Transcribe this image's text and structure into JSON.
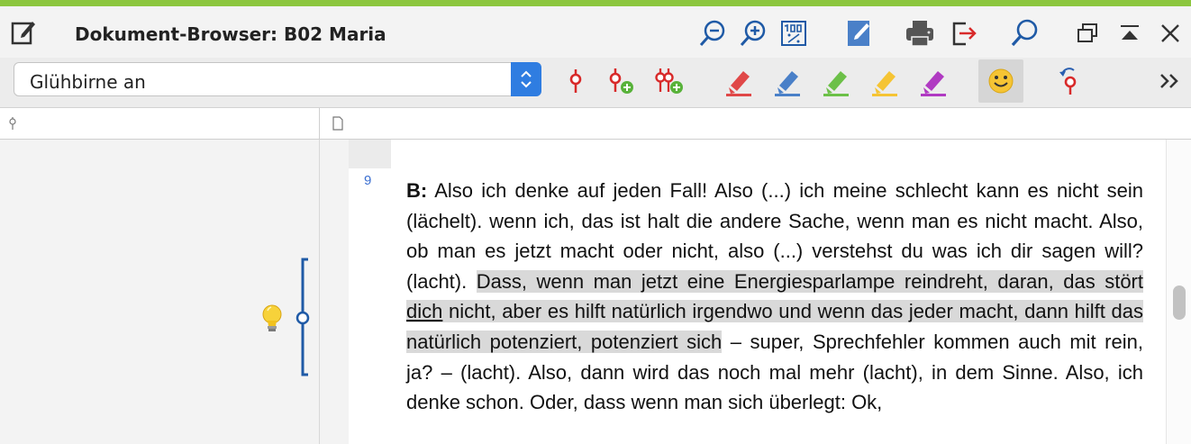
{
  "window": {
    "title": "Dokument-Browser: B02 Maria",
    "accent_color": "#8cc63f",
    "buttons": [
      "zoom-out-icon",
      "zoom-in-icon",
      "percent-zoom-icon",
      "edit-mode-icon",
      "print-icon",
      "export-icon",
      "search-icon",
      "restore-window-icon",
      "minimize-window-icon",
      "close-icon"
    ]
  },
  "toolbar": {
    "code_selector": {
      "value": "Glühbirne an"
    },
    "tools": [
      "code-icon",
      "code-add-icon",
      "code-add-multiple-icon",
      "highlight-red-icon",
      "highlight-blue-icon",
      "highlight-green-icon",
      "highlight-yellow-icon",
      "highlight-purple-icon",
      "emoticon-icon",
      "undo-code-icon",
      "more-chevrons-icon"
    ],
    "highlight_colors": {
      "red": "#e04848",
      "blue": "#4a80c8",
      "green": "#6cc048",
      "yellow": "#f5c434",
      "purple": "#b03ac2"
    }
  },
  "document": {
    "paragraph_number": "9",
    "speaker": "B:",
    "text_before": " Also ich denke auf jeden Fall! Also (...) ich meine schlecht kann es nicht sein (lächelt). wenn ich, das ist halt die andere Sache, wenn man es nicht macht. Also, ob man es jetzt macht oder nicht, also (...) verstehst du was ich dir sagen will? (lacht). ",
    "highlight_a": "Dass, wenn man jetzt eine Energiesparlampe reindreht, daran, das stört ",
    "highlight_underlined": "dich",
    "highlight_b": " nicht, aber es hilft natürlich irgendwo und wenn das jeder macht, dann hilft das natürlich potenziert, potenziert sich",
    "text_after": " – super, Sprechfehler kommen auch mit rein, ja? – (lacht). Also, dann wird das noch mal mehr (lacht),  in dem Sinne. Also, ich denke schon. Oder, dass wenn man sich überlegt: Ok,",
    "coding": {
      "icon": "lightbulb-icon",
      "bracket_color": "#1f5aa6"
    }
  }
}
